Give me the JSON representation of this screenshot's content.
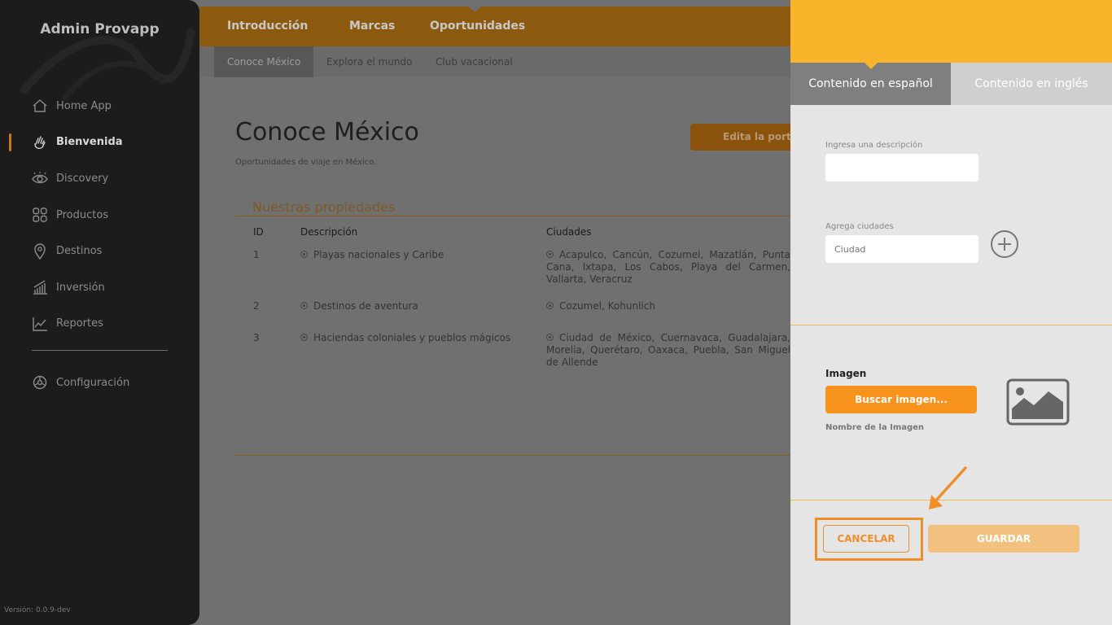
{
  "sidebar": {
    "brand": "Admin Provapp",
    "items": [
      {
        "label": "Home App",
        "icon": "home-icon"
      },
      {
        "label": "Bienvenida",
        "icon": "wave-hand-icon",
        "active": true
      },
      {
        "label": "Discovery",
        "icon": "eye-icon"
      },
      {
        "label": "Productos",
        "icon": "grid-icon"
      },
      {
        "label": "Destinos",
        "icon": "location-pin-icon"
      },
      {
        "label": "Inversión",
        "icon": "bar-chart-icon"
      },
      {
        "label": "Reportes",
        "icon": "line-chart-icon"
      }
    ],
    "config": {
      "label": "Configuración",
      "icon": "gear-icon"
    },
    "version": "Versión: 0.0.9-dev"
  },
  "topbar": {
    "tabs": [
      "Introducción",
      "Marcas",
      "Oportunidades"
    ]
  },
  "subbar": {
    "tabs": [
      "Conoce México",
      "Explora el mundo",
      "Club vacacional"
    ]
  },
  "page": {
    "title": "Conoce México",
    "subtitle": "Oportunidades de viaje en México.",
    "edit_button": "Edita la porta"
  },
  "properties": {
    "title": "Nuestras propiedades",
    "headers": [
      "ID",
      "Descripción",
      "Ciudades"
    ],
    "rows": [
      {
        "id": "1",
        "description": "Playas nacionales y Caribe",
        "cities": "Acapulco, Cancún, Cozumel, Mazatlán, Punta Cana, Ixtapa, Los Cabos, Playa del Carmen, Vallarta, Veracruz"
      },
      {
        "id": "2",
        "description": "Destinos de aventura",
        "cities": "Cozumel, Kohunlich"
      },
      {
        "id": "3",
        "description": "Haciendas coloniales y pueblos mágicos",
        "cities": "Ciudad de México, Cuernavaca, Guadalajara, Morelia, Querétaro, Oaxaca, Puebla, San Miguel de Allende"
      }
    ]
  },
  "panel": {
    "tabs": [
      "Contenido en español",
      "Contenido en inglés"
    ],
    "description_label": "Ingresa una descripción",
    "description_value": "",
    "cities_label": "Agrega ciudades",
    "cities_placeholder": "Ciudad",
    "image_title": "Imagen",
    "search_image_button": "Buscar imagen...",
    "image_name": "Nombre de la Imagen",
    "cancel_button": "CANCELAR",
    "save_button": "GUARDAR"
  },
  "colors": {
    "accent": "#f7921d",
    "panel_header": "#f8b42a",
    "sidebar_bg": "#1c1c1c"
  }
}
